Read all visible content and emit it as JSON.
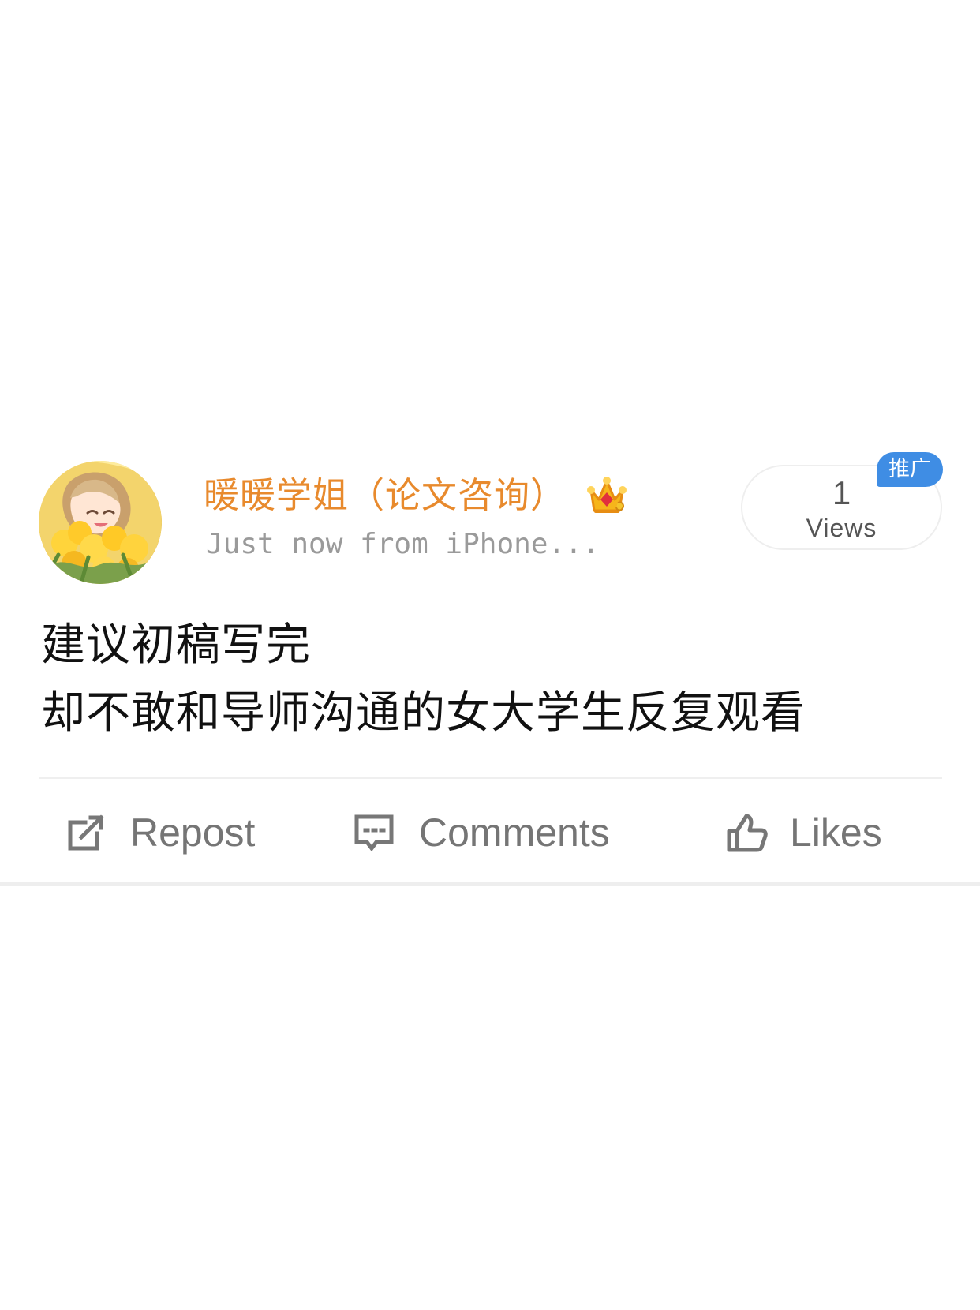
{
  "post": {
    "author": {
      "name": "暖暖学姐（论文咨询）",
      "meta": "Just now from iPhone...",
      "avatar_icon": "profile-avatar-yellow-roses",
      "badge_icon": "crown-vip-icon"
    },
    "stats": {
      "views_count": "1",
      "views_label": "Views",
      "promotion_label": "推广"
    },
    "content": {
      "line_1": "建议初稿写完",
      "line_2": "却不敢和导师沟通的女大学生反复观看"
    },
    "actions": {
      "repost_label": "Repost",
      "comments_label": "Comments",
      "likes_label": "Likes"
    }
  },
  "colors": {
    "username": "#e88a2d",
    "meta_text": "#9a9a9a",
    "content_text": "#111111",
    "action_text": "#757575",
    "promotion_badge": "#3f8de4"
  }
}
